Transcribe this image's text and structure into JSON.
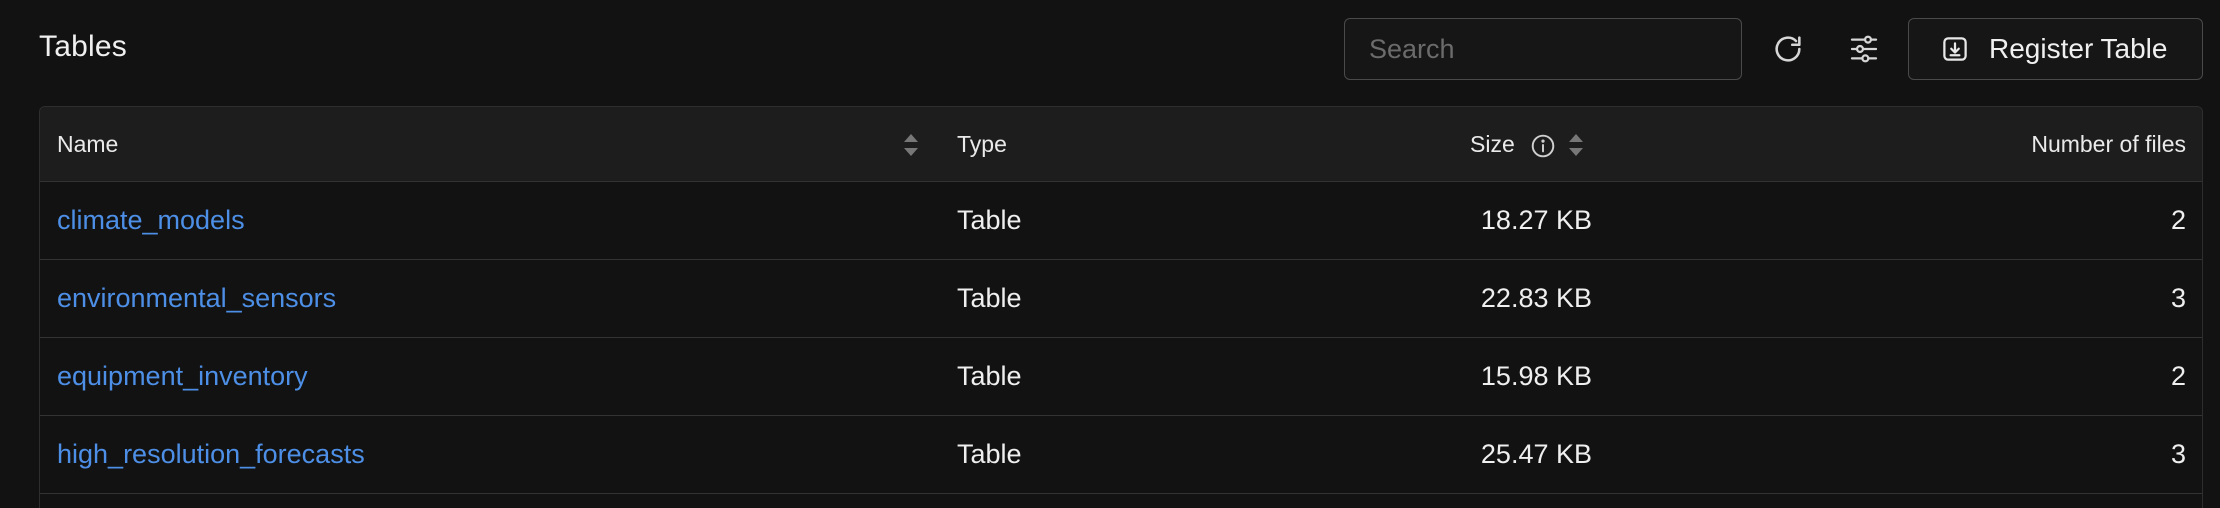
{
  "header": {
    "title": "Tables",
    "search": {
      "placeholder": "Search",
      "value": ""
    },
    "refresh_icon": "refresh-icon",
    "filter_icon": "sliders-icon",
    "register_button": {
      "label": "Register Table",
      "icon": "download-box-icon"
    }
  },
  "table": {
    "columns": {
      "name": "Name",
      "type": "Type",
      "size": "Size",
      "files": "Number of files"
    },
    "rows": [
      {
        "name": "climate_models",
        "type": "Table",
        "size": "18.27 KB",
        "files": "2"
      },
      {
        "name": "environmental_sensors",
        "type": "Table",
        "size": "22.83 KB",
        "files": "3"
      },
      {
        "name": "equipment_inventory",
        "type": "Table",
        "size": "15.98 KB",
        "files": "2"
      },
      {
        "name": "high_resolution_forecasts",
        "type": "Table",
        "size": "25.47 KB",
        "files": "3"
      }
    ]
  },
  "colors": {
    "background": "#121212",
    "link": "#4d8fe6",
    "border": "#333333",
    "header_bg": "#1d1d1d"
  }
}
